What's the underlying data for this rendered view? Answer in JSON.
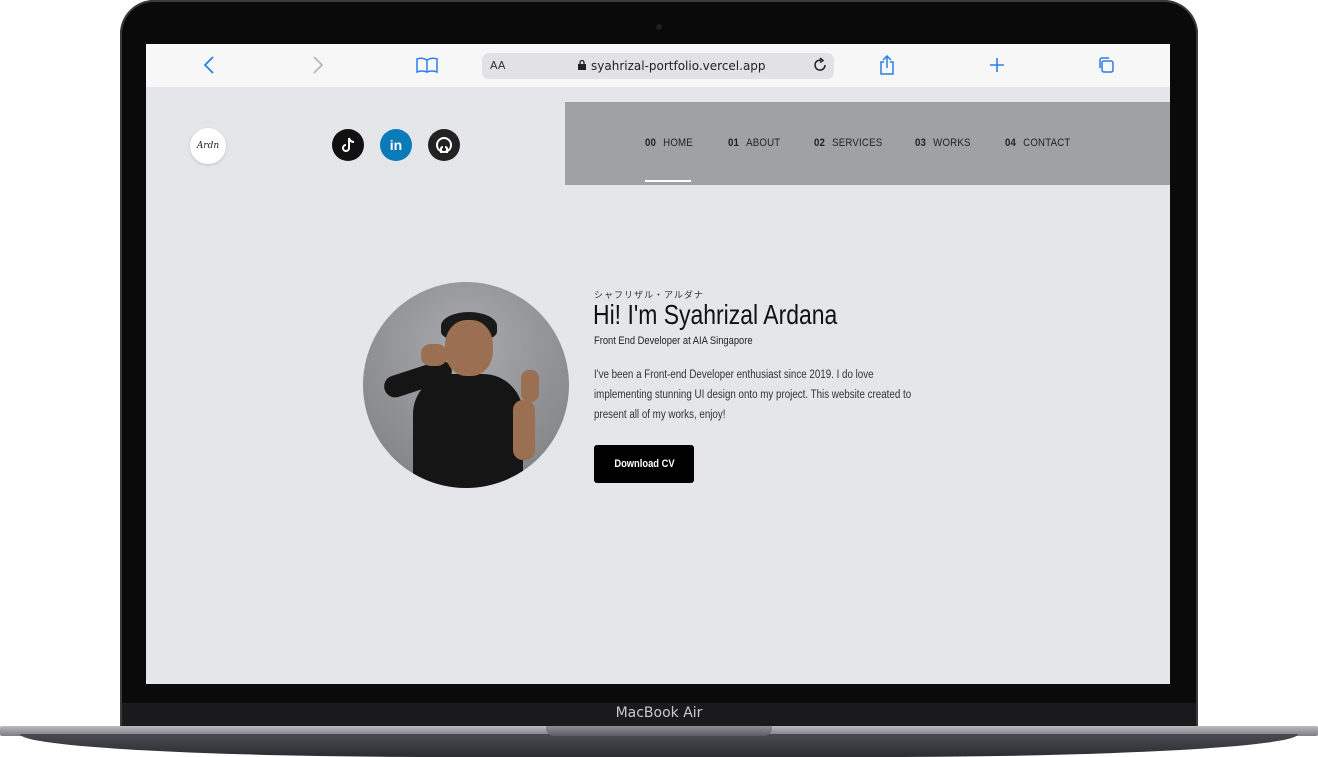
{
  "device": {
    "label": "MacBook Air"
  },
  "browser": {
    "reader_label": "AA",
    "url": "syahrizal-portfolio.vercel.app",
    "accent": "#2b7de9"
  },
  "site": {
    "logo_text": "Ardn",
    "social": [
      {
        "name": "tiktok",
        "color": "#111111"
      },
      {
        "name": "linkedin",
        "label": "in",
        "color": "#0a7ab8"
      },
      {
        "name": "github",
        "color": "#222222"
      }
    ],
    "nav": [
      {
        "num": "00",
        "label": "HOME",
        "active": true
      },
      {
        "num": "01",
        "label": "ABOUT"
      },
      {
        "num": "02",
        "label": "SERVICES"
      },
      {
        "num": "03",
        "label": "WORKS"
      },
      {
        "num": "04",
        "label": "CONTACT"
      }
    ],
    "hero": {
      "japanese_name": "シャフリザル・アルダナ",
      "title": "Hi! I'm Syahrizal Ardana",
      "subtitle": "Front End Developer at AIA Singapore",
      "description": "I've been a Front-end Developer enthusiast since 2019. I do love implementing stunning UI design onto my project. This website created to present all of my works, enjoy!",
      "cta_label": "Download CV"
    },
    "colors": {
      "background": "#e5e6ea",
      "nav_bg": "#a0a1a5",
      "button": "#000000"
    }
  }
}
